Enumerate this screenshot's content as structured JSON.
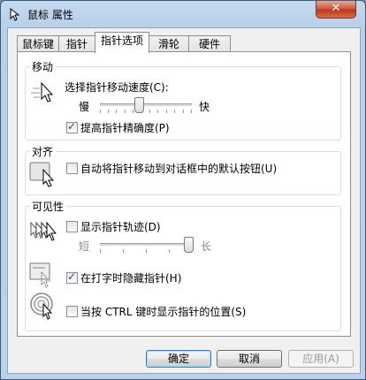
{
  "window": {
    "title": "鼠标 属性",
    "close_label": "✕"
  },
  "tabs": [
    {
      "label": "鼠标键"
    },
    {
      "label": "指针"
    },
    {
      "label": "指针选项"
    },
    {
      "label": "滑轮"
    },
    {
      "label": "硬件"
    }
  ],
  "active_tab": "指针选项",
  "motion": {
    "group_label": "移动",
    "speed_label": "选择指针移动速度(C):",
    "slow_label": "慢",
    "fast_label": "快",
    "speed_value_fraction": 0.42,
    "precision_label": "提高指针精确度(P)",
    "precision_checked": true
  },
  "snap": {
    "group_label": "对齐",
    "snap_label": "自动将指针移动到对话框中的默认按钮(U)",
    "snap_checked": false
  },
  "visibility": {
    "group_label": "可见性",
    "trails_label": "显示指针轨迹(D)",
    "trails_checked": false,
    "short_label": "短",
    "long_label": "长",
    "trails_value_fraction": 0.96,
    "hide_label": "在打字时隐藏指针(H)",
    "hide_checked": true,
    "ctrl_label": "当按 CTRL 键时显示指针的位置(S)",
    "ctrl_checked": false
  },
  "buttons": {
    "ok": "确定",
    "cancel": "取消",
    "apply": "应用(A)"
  }
}
